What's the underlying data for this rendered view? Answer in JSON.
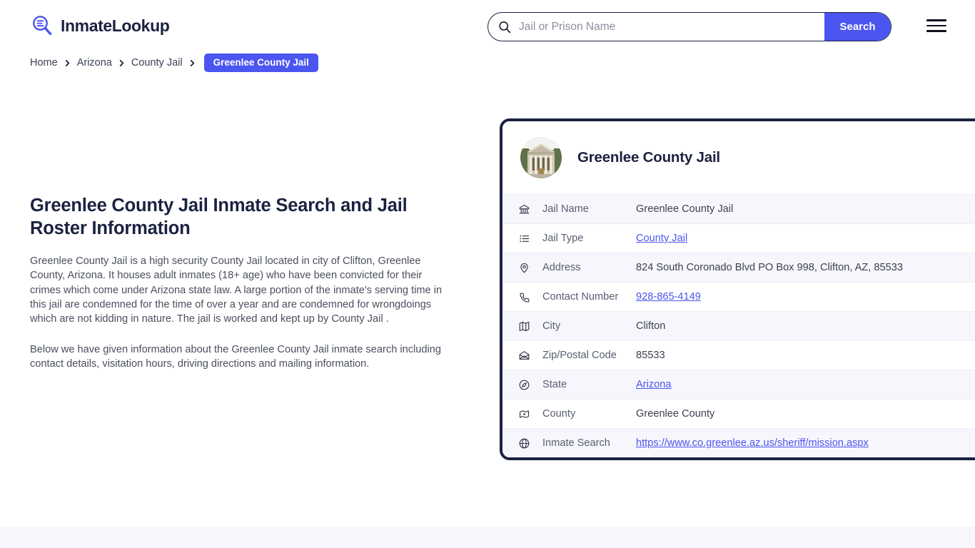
{
  "brand": {
    "name": "InmateLookup",
    "icon": "magnifier-list-icon"
  },
  "search": {
    "placeholder": "Jail or Prison Name",
    "value": "",
    "button_label": "Search",
    "icon": "search-icon"
  },
  "menu": {
    "icon": "hamburger-icon"
  },
  "breadcrumb": {
    "items": [
      {
        "label": "Home"
      },
      {
        "label": "Arizona"
      },
      {
        "label": "County Jail"
      }
    ],
    "current": "Greenlee County Jail"
  },
  "main": {
    "title": "Greenlee County Jail Inmate Search and Jail Roster Information",
    "paragraph1": "Greenlee County Jail is a high security County Jail located in city of Clifton, Greenlee County, Arizona. It houses adult inmates (18+ age) who have been convicted for their crimes which come under Arizona state law. A large portion of the inmate's serving time in this jail are condemned for the time of over a year and are condemned for wrongdoings which are not kidding in nature. The jail is worked and kept up by County Jail .",
    "paragraph2": "Below we have given information about the Greenlee County Jail inmate search including contact details, visitation hours, driving directions and mailing information."
  },
  "card": {
    "title": "Greenlee County Jail",
    "avatar_icon": "courthouse-photo",
    "rows": [
      {
        "icon": "bank-icon",
        "label": "Jail Name",
        "value": "Greenlee County Jail",
        "link": false
      },
      {
        "icon": "list-icon",
        "label": "Jail Type",
        "value": "County Jail",
        "link": true
      },
      {
        "icon": "map-pin-icon",
        "label": "Address",
        "value": "824 South Coronado Blvd PO Box 998, Clifton, AZ, 85533",
        "link": false
      },
      {
        "icon": "phone-icon",
        "label": "Contact Number",
        "value": "928-865-4149",
        "link": true
      },
      {
        "icon": "map-icon",
        "label": "City",
        "value": "Clifton",
        "link": false
      },
      {
        "icon": "mail-icon",
        "label": "Zip/Postal Code",
        "value": "85533",
        "link": false
      },
      {
        "icon": "compass-icon",
        "label": "State",
        "value": "Arizona",
        "link": true
      },
      {
        "icon": "county-icon",
        "label": "County",
        "value": "Greenlee County",
        "link": false
      },
      {
        "icon": "globe-icon",
        "label": "Inmate Search",
        "value": "https://www.co.greenlee.az.us/sheriff/mission.aspx",
        "link": true
      }
    ]
  },
  "colors": {
    "accent": "#4b55ef",
    "dark": "#1b2240",
    "row_alt": "#f6f6fc",
    "text_body": "#4a4f5e"
  }
}
